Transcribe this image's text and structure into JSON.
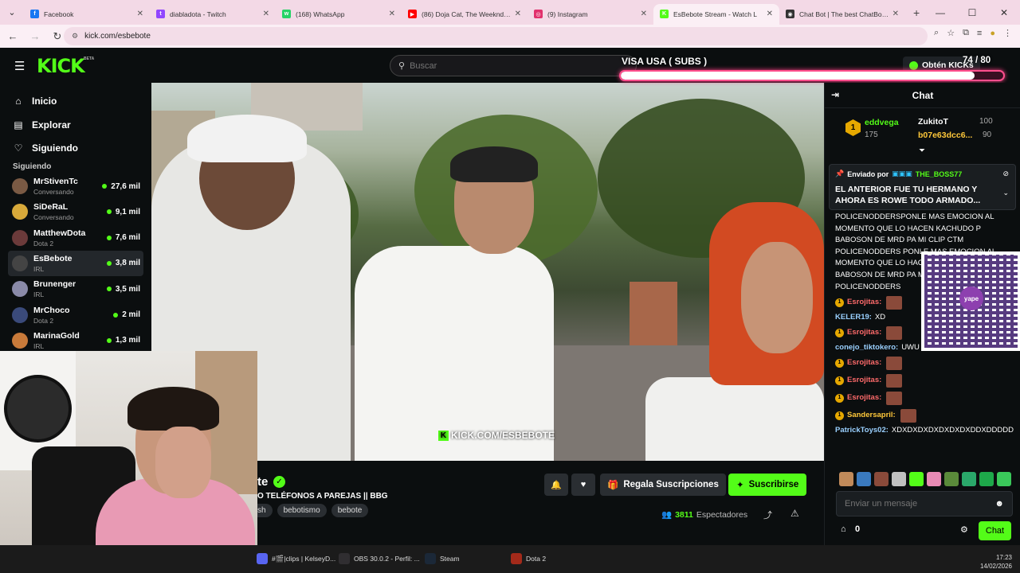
{
  "browser": {
    "tabs": [
      {
        "label": "Facebook",
        "color": "#1877f2",
        "glyph": "f"
      },
      {
        "label": "diabladota - Twitch",
        "color": "#9146ff",
        "glyph": "t"
      },
      {
        "label": "(168) WhatsApp",
        "color": "#25d366",
        "glyph": "w"
      },
      {
        "label": "(86) Doja Cat, The Weeknd - Yo",
        "color": "#ff0000",
        "glyph": "▶"
      },
      {
        "label": "(9) Instagram",
        "color": "#e1306c",
        "glyph": "◎"
      },
      {
        "label": "EsBebote Stream - Watch L",
        "color": "#53fc18",
        "glyph": "K"
      },
      {
        "label": "Chat Bot | The best ChatBot an",
        "color": "#333333",
        "glyph": "◉"
      }
    ],
    "url": "kick.com/esbebote"
  },
  "header": {
    "search_placeholder": "Buscar",
    "get_kicks": "Obtén KICKs"
  },
  "overlay": {
    "goal_title": "VISA USA ( SUBS )",
    "goal_count": "74 / 80",
    "goal_progress": 0.925
  },
  "sidebar": {
    "nav": [
      {
        "label": "Inicio",
        "icon": "home-icon"
      },
      {
        "label": "Explorar",
        "icon": "compass-icon"
      },
      {
        "label": "Siguiendo",
        "icon": "heart-icon"
      }
    ],
    "following_label": "Siguiendo",
    "channels": [
      {
        "name": "MrStivenTc",
        "category": "Conversando",
        "viewers": "27,6 mil",
        "color": "#7a5a44"
      },
      {
        "name": "SiDeRaL",
        "category": "Conversando",
        "viewers": "9,1 mil",
        "color": "#d8a93a"
      },
      {
        "name": "MatthewDota",
        "category": "Dota 2",
        "viewers": "7,6 mil",
        "color": "#6b3a3a"
      },
      {
        "name": "EsBebote",
        "category": "IRL",
        "viewers": "3,8 mil",
        "color": "#444444"
      },
      {
        "name": "Brunenger",
        "category": "IRL",
        "viewers": "3,5 mil",
        "color": "#8a8aa8"
      },
      {
        "name": "MrChoco",
        "category": "Dota 2",
        "viewers": "2 mil",
        "color": "#3a4a7a"
      },
      {
        "name": "MarinaGold",
        "category": "IRL",
        "viewers": "1,3 mil",
        "color": "#c87a3a"
      }
    ]
  },
  "video": {
    "watermark": "KICK.COM/ESBEBOTE"
  },
  "stream_info": {
    "name_fragment": "te",
    "title_fragment": "O TELÉFONOS A PAREJAS || BBG",
    "tags": [
      "sh",
      "bebotismo",
      "bebote"
    ],
    "gift_label": "Regala Suscripciones",
    "subscribe_label": "Suscribirse",
    "viewers_count": "3811",
    "viewers_label": "Espectadores"
  },
  "chat": {
    "title": "Chat",
    "leaderboard": {
      "first_name": "eddvega",
      "first_value": "175",
      "second_name": "ZukitoT",
      "second_value": "100",
      "third_name": "b07e63dcc6...",
      "third_value": "90"
    },
    "pinned": {
      "sent_by_label": "Enviado por",
      "sent_by_user": "THE_BOSS77",
      "message": "EL ANTERIOR FUE TU HERMANO Y AHORA ES ROWE TODO ARMADO..."
    },
    "spam_text": "POLICENODDERSPONLE MAS EMOCION AL MOMENTO QUE LO HACEN KACHUDO P BABOSON DE MRD PA MI CLIP CTM POLICENODDERS PONLE MAS EMOCION AL MOMENTO QUE LO HACEN KACHUDO P BABOSON DE MRD PA MI CLIP CTM POLICENODDERS",
    "messages": [
      {
        "user": "Esrojitas:",
        "text": "",
        "badge": true,
        "emote": true,
        "color": "#ff6b6b"
      },
      {
        "user": "KELER19:",
        "text": "XD",
        "badge": false,
        "emote": false,
        "color": "#9ad0ff"
      },
      {
        "user": "Esrojitas:",
        "text": "",
        "badge": true,
        "emote": true,
        "color": "#ff6b6b"
      },
      {
        "user": "conejo_tiktokero:",
        "text": "UWU",
        "badge": false,
        "emote": false,
        "color": "#9ad0ff"
      },
      {
        "user": "Esrojitas:",
        "text": "",
        "badge": true,
        "emote": true,
        "color": "#ff6b6b"
      },
      {
        "user": "Esrojitas:",
        "text": "",
        "badge": true,
        "emote": true,
        "color": "#ff6b6b"
      },
      {
        "user": "Esrojitas:",
        "text": "",
        "badge": true,
        "emote": true,
        "color": "#ff6b6b"
      },
      {
        "user": "Sandersapril:",
        "text": "",
        "badge": true,
        "emote": true,
        "color": "#ffc83a"
      },
      {
        "user": "PatrickToys02:",
        "text": "XDXDXDXDXDXDXDXDDXDDDDD",
        "badge": false,
        "emote": false,
        "color": "#9ad0ff"
      }
    ],
    "qr_label": "yape",
    "input_placeholder": "Enviar un mensaje",
    "points": "0",
    "send_label": "Chat"
  },
  "taskbar": {
    "items": [
      {
        "label": "#🎬|clips | KelseyD...",
        "color": "#5865f2"
      },
      {
        "label": "OBS 30.0.2 - Perfil: ...",
        "color": "#302e31"
      },
      {
        "label": "Steam",
        "color": "#1b2838"
      },
      {
        "label": "Dota 2",
        "color": "#a32a1a"
      }
    ],
    "time": "17:23",
    "date": "14/02/2026"
  }
}
